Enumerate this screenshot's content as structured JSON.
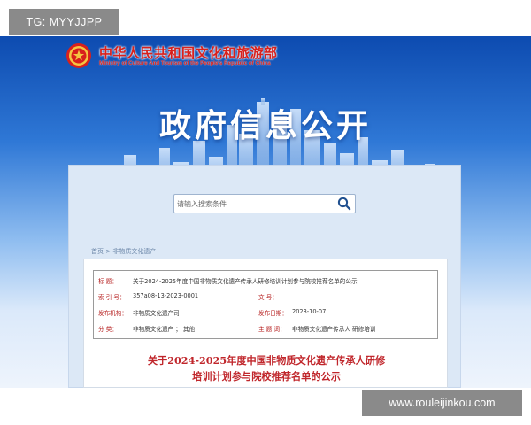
{
  "watermarks": {
    "top_left": "TG: MYYJJPP",
    "bottom_right": "www.rouleijinkou.com"
  },
  "header": {
    "ministry_cn": "中华人民共和国文化和旅游部",
    "ministry_en": "Ministry of Culture And Tourism of the People's Republic of China",
    "hero_title": "政府信息公开",
    "emblem_icon": "national-emblem-icon"
  },
  "search": {
    "placeholder": "请输入搜索条件",
    "icon": "search-icon"
  },
  "breadcrumb": {
    "items": [
      "首页",
      "非物质文化遗产"
    ],
    "separator": " > "
  },
  "document": {
    "meta": [
      {
        "label": "标    题：",
        "value": "关于2024-2025年度中国非物质文化遗产传承人研修培训计划参与院校推荐名单的公示"
      },
      {
        "label": "索 引 号：",
        "value": "357a08-13-2023-0001",
        "label2": "文    号：",
        "value2": ""
      },
      {
        "label": "发布机构：",
        "value": "非物质文化遗产司",
        "label2": "发布日期：",
        "value2": "2023-10-07"
      },
      {
        "label": "分    类：",
        "value": "非物质文化遗产 ；  其他",
        "label2": "主 题 词：",
        "value2": "非物质文化遗产传承人 研修培训"
      }
    ],
    "title_line1": "关于2024-2025年度中国非物质文化遗产传承人研修",
    "title_line2": "培训计划参与院校推荐名单的公示"
  },
  "colors": {
    "accent_red": "#c0262b",
    "banner_blue": "#0d4bb0"
  }
}
